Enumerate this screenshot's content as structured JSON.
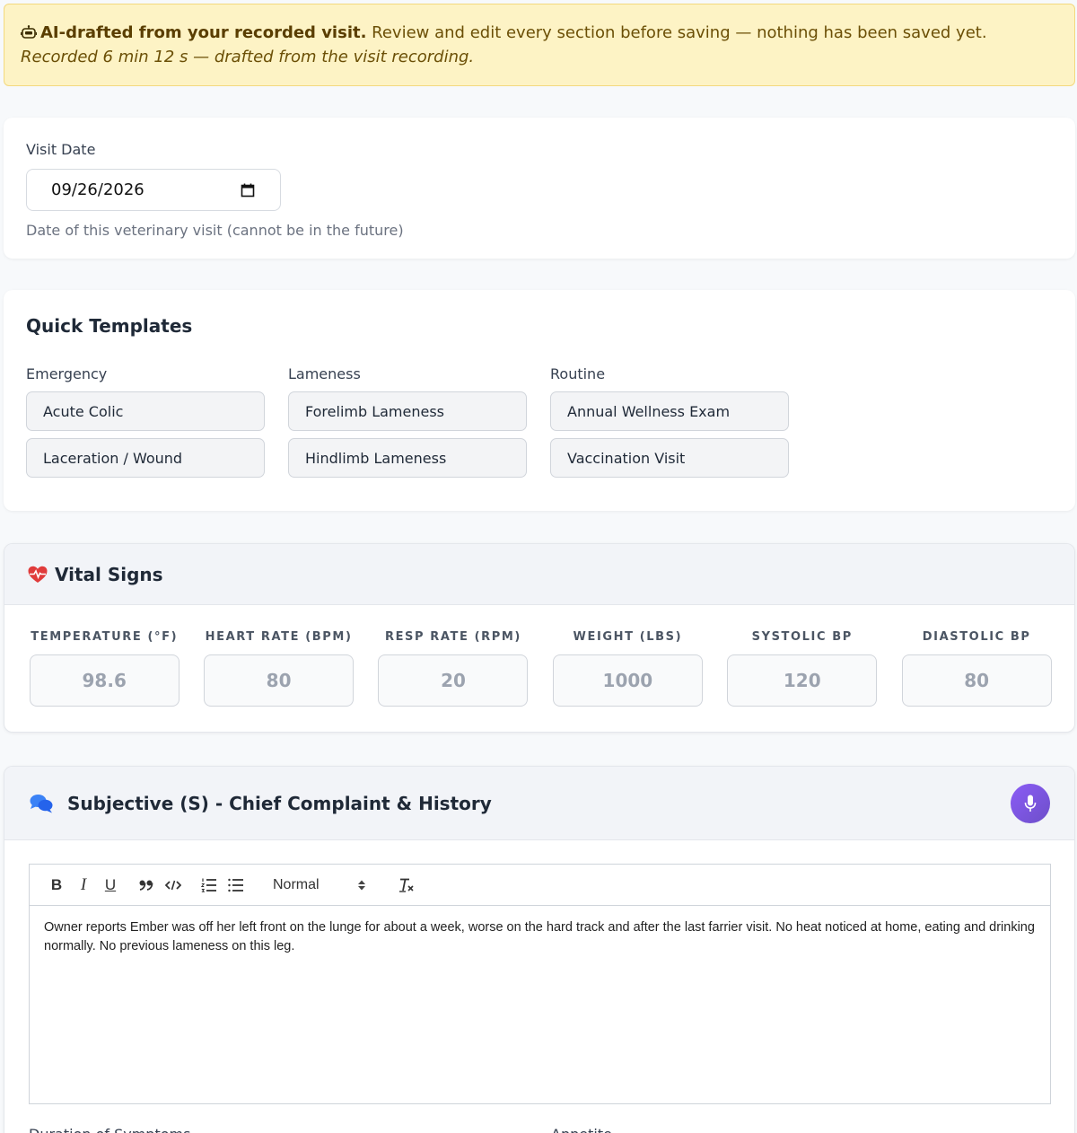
{
  "banner": {
    "icon": "robot-icon",
    "strong": "AI-drafted from your recorded visit.",
    "text": " Review and edit every section before saving — nothing has been saved yet.",
    "subtext": "Recorded 6 min 12 s — drafted from the visit recording."
  },
  "visit_date": {
    "label": "Visit Date",
    "value": "09/26/2026",
    "helper": "Date of this veterinary visit (cannot be in the future)"
  },
  "templates": {
    "title": "Quick Templates",
    "groups": [
      {
        "label": "Emergency",
        "items": [
          "Acute Colic",
          "Laceration / Wound"
        ]
      },
      {
        "label": "Lameness",
        "items": [
          "Forelimb Lameness",
          "Hindlimb Lameness"
        ]
      },
      {
        "label": "Routine",
        "items": [
          "Annual Wellness Exam",
          "Vaccination Visit"
        ]
      }
    ]
  },
  "vitals": {
    "title": "Vital Signs",
    "fields": [
      {
        "label": "TEMPERATURE (°F)",
        "placeholder": "98.6"
      },
      {
        "label": "HEART RATE (BPM)",
        "placeholder": "80"
      },
      {
        "label": "RESP RATE (RPM)",
        "placeholder": "20"
      },
      {
        "label": "WEIGHT (LBS)",
        "placeholder": "1000"
      },
      {
        "label": "SYSTOLIC BP",
        "placeholder": "120"
      },
      {
        "label": "DIASTOLIC BP",
        "placeholder": "80"
      }
    ]
  },
  "subjective": {
    "title": "Subjective (S) - Chief Complaint & History",
    "toolbar": {
      "bold": "B",
      "italic": "I",
      "underline": "U",
      "header_select": "Normal"
    },
    "body": "Owner reports Ember was off her left front on the lunge for about a week, worse on the hard track and after the last farrier visit. No heat noticed at home, eating and drinking normally. No previous lameness on this leg.",
    "below_labels": [
      "Duration of Symptoms",
      "Appetite"
    ]
  },
  "colors": {
    "accent": "#7c5ce0",
    "banner_bg": "#fdf3c5",
    "heart": "#e03b3b",
    "chat": "#3b82f6"
  }
}
